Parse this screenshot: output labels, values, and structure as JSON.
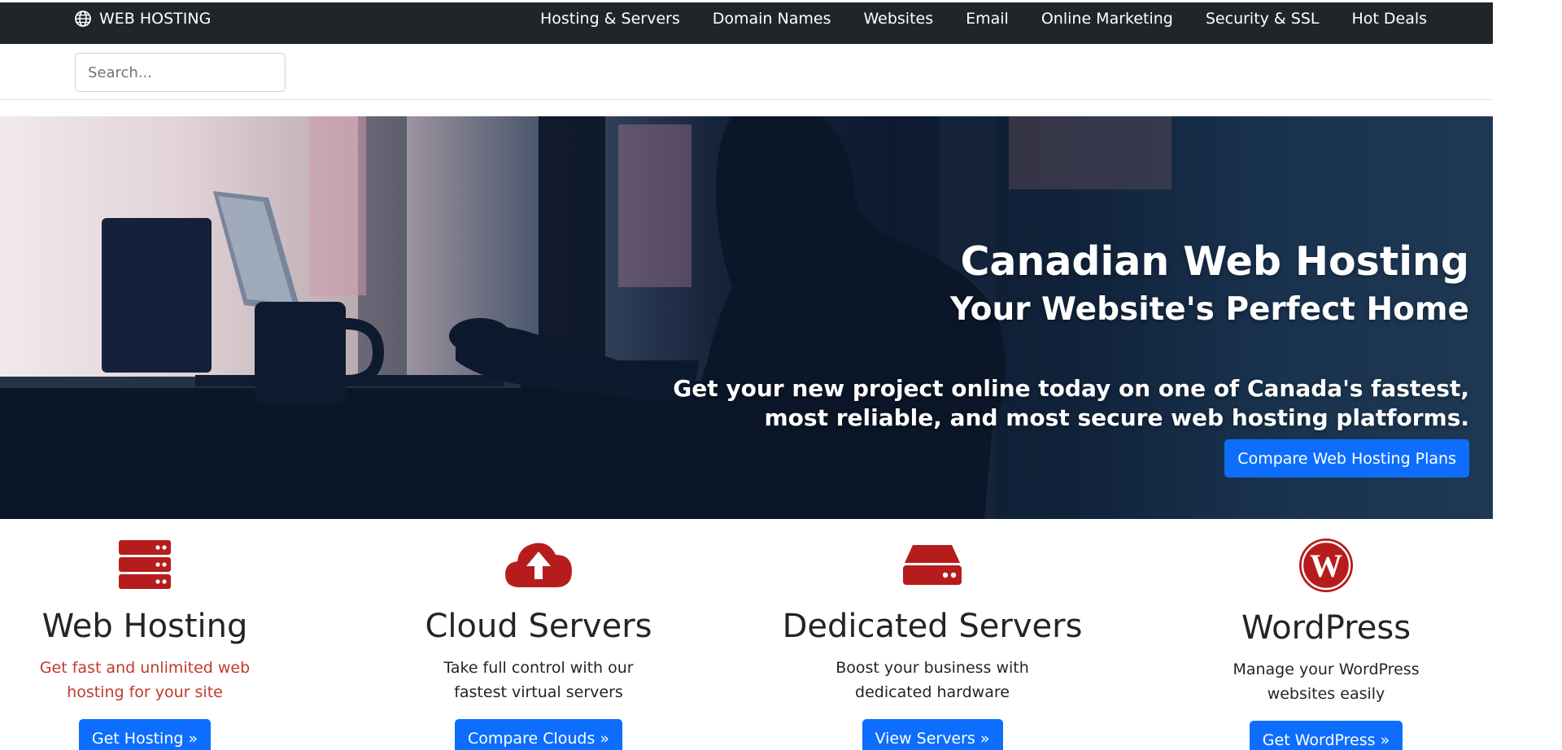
{
  "navbar": {
    "brand_icon": "globe-icon",
    "brand_label": "WEB HOSTING",
    "links": [
      {
        "label": "Hosting & Servers"
      },
      {
        "label": "Domain Names"
      },
      {
        "label": "Websites"
      },
      {
        "label": "Email"
      },
      {
        "label": "Online Marketing"
      },
      {
        "label": "Security & SSL"
      },
      {
        "label": "Hot Deals"
      }
    ]
  },
  "search": {
    "placeholder": "Search...",
    "value": ""
  },
  "hero": {
    "title": "Canadian Web Hosting",
    "subtitle": "Your Website's Perfect Home",
    "description": "Get your new project online today on one of Canada's fastest, most reliable, and most secure web hosting platforms.",
    "button_label": "Compare Web Hosting Plans"
  },
  "features": [
    {
      "icon": "server-stack-icon",
      "title": "Web Hosting",
      "description": "Get fast and unlimited web hosting for your site",
      "button_label": "Get Hosting »"
    },
    {
      "icon": "cloud-upload-icon",
      "title": "Cloud Servers",
      "description": "Take full control with our fastest virtual servers",
      "button_label": "Compare Clouds »"
    },
    {
      "icon": "hard-drive-icon",
      "title": "Dedicated Servers",
      "description": "Boost your business with dedicated hardware",
      "button_label": "View Servers »"
    },
    {
      "icon": "wordpress-icon",
      "title": "WordPress",
      "description": "Manage your WordPress websites easily",
      "button_label": "Get WordPress »"
    }
  ],
  "colors": {
    "nav_bg": "#212529",
    "primary": "#0d6efd",
    "icon_red": "#b71c1c",
    "accent_red_text": "#c0392b"
  }
}
